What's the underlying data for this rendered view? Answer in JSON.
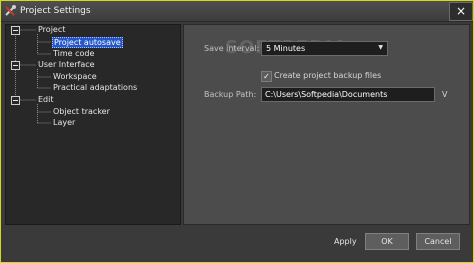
{
  "window": {
    "title": "Project Settings",
    "close_glyph": "×",
    "icons": {
      "app": "tools-icon",
      "close": "close-icon"
    },
    "border_color": "#d8d81a"
  },
  "tree": {
    "nodes": [
      {
        "label": "Project",
        "selected": false
      },
      {
        "label": "Project autosave",
        "selected": true
      },
      {
        "label": "Time code",
        "selected": false
      },
      {
        "label": "User Interface",
        "selected": false
      },
      {
        "label": "Workspace",
        "selected": false
      },
      {
        "label": "Practical adaptations",
        "selected": false
      },
      {
        "label": "Edit",
        "selected": false
      },
      {
        "label": "Object tracker",
        "selected": false
      },
      {
        "label": "Layer",
        "selected": false
      }
    ],
    "selection_color": "#2557c9"
  },
  "settings": {
    "save_interval_label": "Save interval:",
    "save_interval_value": "5 Minutes",
    "backup_checkbox_label": "Create project backup files",
    "backup_checked": true,
    "backup_path_label": "Backup Path:",
    "backup_path_value": "C:\\Users\\Softpedia\\Documents",
    "browse_label": "V"
  },
  "watermark": "SOFTPEDIA",
  "footer": {
    "apply_label": "Apply",
    "ok_label": "OK",
    "cancel_label": "Cancel"
  }
}
